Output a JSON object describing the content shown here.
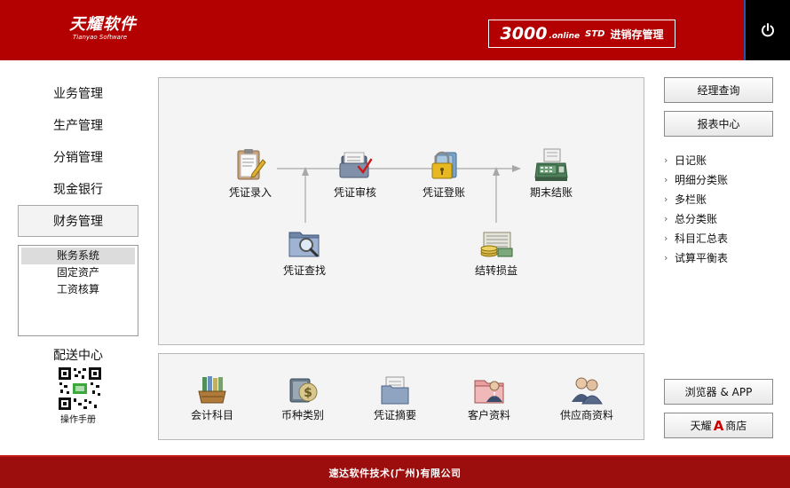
{
  "header": {
    "logo_cn": "天耀软件",
    "logo_en": "Tianyao Software",
    "product_num": "3000",
    "product_online": ".online",
    "product_std": "STD",
    "product_title": "进销存管理"
  },
  "sidebar": {
    "items": [
      {
        "label": "业务管理"
      },
      {
        "label": "生产管理"
      },
      {
        "label": "分销管理"
      },
      {
        "label": "现金银行"
      },
      {
        "label": "财务管理"
      }
    ],
    "submenu": [
      {
        "label": "账务系统"
      },
      {
        "label": "固定资产"
      },
      {
        "label": "工资核算"
      }
    ],
    "delivery_label": "配送中心",
    "manual_label": "操作手册"
  },
  "flow": {
    "voucher_entry": "凭证录入",
    "voucher_review": "凭证审核",
    "voucher_post": "凭证登账",
    "period_close": "期末结账",
    "voucher_search": "凭证查找",
    "carry_forward": "结转损益"
  },
  "bottom": {
    "accounts": "会计科目",
    "currency": "币种类别",
    "summary": "凭证摘要",
    "customers": "客户资料",
    "suppliers": "供应商资料"
  },
  "right": {
    "manager_query": "经理查询",
    "report_center": "报表中心",
    "links": [
      "日记账",
      "明细分类账",
      "多栏账",
      "总分类账",
      "科目汇总表",
      "试算平衡表"
    ],
    "browser_app": "浏览器 & APP",
    "store_prefix": "天耀",
    "store_a": "A",
    "store_suffix": "商店"
  },
  "footer": {
    "company": "速达软件技术(广州)有限公司"
  },
  "colors": {
    "brand_red": "#b30000",
    "footer_red": "#9c0d0d"
  }
}
